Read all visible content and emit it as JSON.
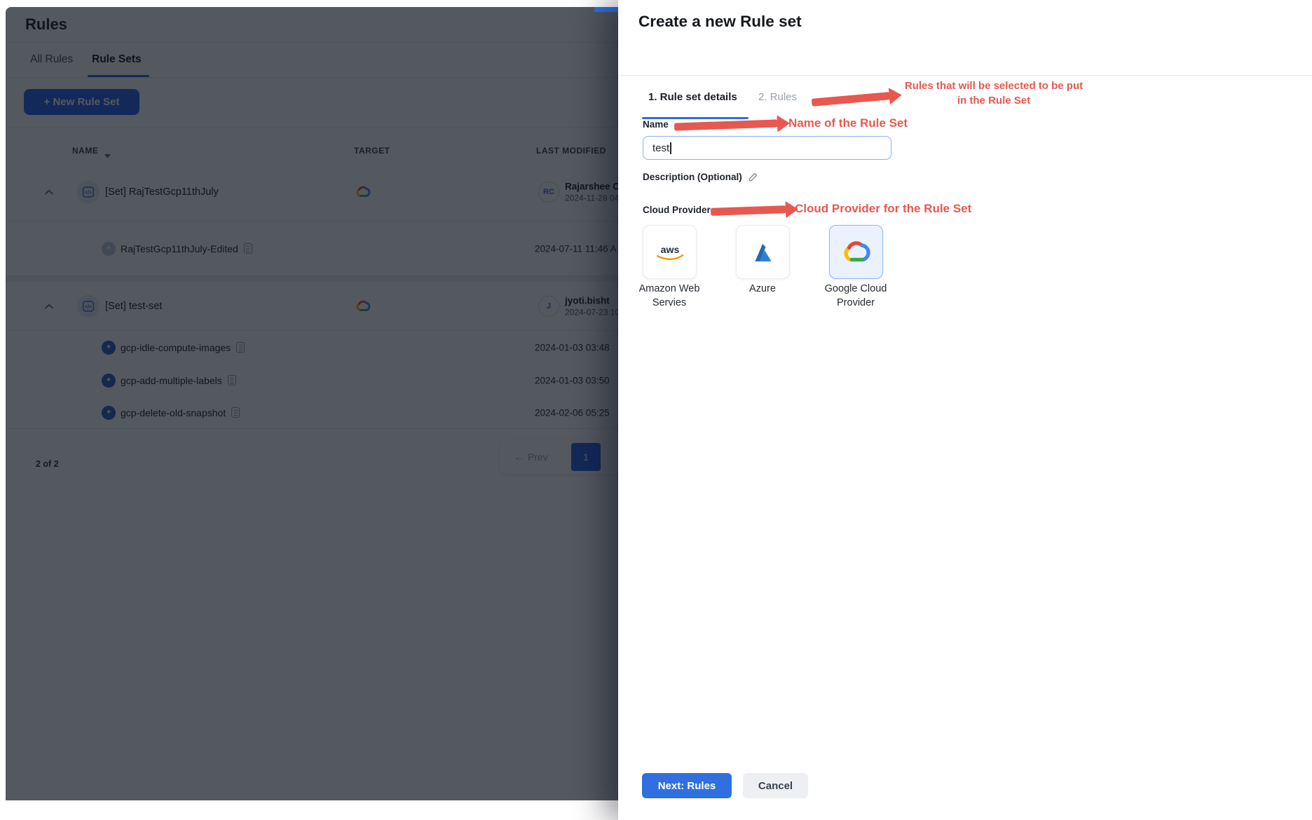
{
  "rules_page": {
    "title": "Rules",
    "tabs": {
      "all_rules": "All Rules",
      "rule_sets": "Rule Sets"
    },
    "new_rule_set_button": "+ New Rule Set",
    "table": {
      "columns": {
        "name": "NAME",
        "target": "TARGET",
        "last_modified": "LAST MODIFIED"
      },
      "groups": [
        {
          "name": "[Set] RajTestGcp11thJuly",
          "target_icon": "gcp-logo",
          "modified_by": "Rajarshee Ch",
          "modified_initials": "RC",
          "modified_date": "2024-11-28 04",
          "rules": [
            {
              "name": "RajTestGcp11thJuly-Edited",
              "modified": "2024-07-11 11:46 A"
            }
          ]
        },
        {
          "name": "[Set] test-set",
          "target_icon": "gcp-logo",
          "modified_by": "jyoti.bisht",
          "modified_initials": "J",
          "modified_date": "2024-07-23 10",
          "rules": [
            {
              "name": "gcp-idle-compute-images",
              "modified": "2024-01-03 03:48"
            },
            {
              "name": "gcp-add-multiple-labels",
              "modified": "2024-01-03 03:50"
            },
            {
              "name": "gcp-delete-old-snapshot",
              "modified": "2024-02-06 05:25"
            }
          ]
        }
      ],
      "footer": {
        "count": "2 of 2",
        "prev_arrow": "←",
        "prev_label": "Prev",
        "page": "1"
      }
    }
  },
  "drawer": {
    "title": "Create a new Rule set",
    "steps": {
      "step1": "1. Rule set details",
      "step2": "2. Rules"
    },
    "form": {
      "name_label": "Name",
      "name_value": "test",
      "description_label": "Description (Optional)",
      "cloud_provider_label": "Cloud Provider",
      "providers": [
        {
          "id": "aws",
          "label": "Amazon Web Servies",
          "selected": false
        },
        {
          "id": "azure",
          "label": "Azure",
          "selected": false
        },
        {
          "id": "gcp",
          "label": "Google Cloud Provider",
          "selected": true
        }
      ]
    },
    "buttons": {
      "next": "Next: Rules",
      "cancel": "Cancel"
    }
  },
  "annotations": {
    "color": "#e7584f",
    "steps_note_line1": "Rules that will be selected to be put",
    "steps_note_line2": "in the Rule Set",
    "name_note": "Name of the Rule Set",
    "provider_note": "Cloud Provider for the Rule Set"
  },
  "colors": {
    "primary_blue": "#2f6fe0",
    "table_blue": "#2563eb",
    "annotation_red": "#e7584f",
    "selected_card_bg": "#e9f2fe",
    "selected_card_border": "#8fb9f0"
  }
}
